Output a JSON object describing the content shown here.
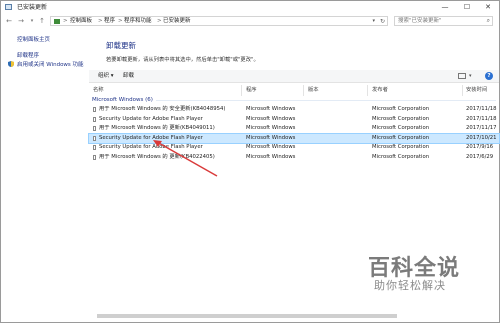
{
  "window": {
    "title": "已安装更新",
    "min_label": "—",
    "max_label": "☐",
    "close_label": "✕"
  },
  "nav": {
    "back": "←",
    "forward": "→",
    "up": "↑",
    "breadcrumbs": [
      "控制面板",
      "程序",
      "程序和功能",
      "已安装更新"
    ],
    "separator": ">",
    "search_placeholder": "搜索\"已安装更新\""
  },
  "sidebar": {
    "items": [
      {
        "label": "控制面板主页"
      },
      {
        "label": "卸载程序"
      },
      {
        "label": "启用或关闭 Windows 功能"
      }
    ]
  },
  "main": {
    "heading": "卸载更新",
    "subtext": "若要卸载更新，请从列表中将其选中，然后单击\"卸载\"或\"更改\"。",
    "toolbar": {
      "organize": "组织 ▾",
      "uninstall": "卸载"
    },
    "columns": [
      "名称",
      "程序",
      "版本",
      "发布者",
      "安装时间"
    ],
    "group": "Microsoft Windows (6)",
    "rows": [
      {
        "name": "用于 Microsoft Windows 的 安全更新(KB4048954)",
        "program": "Microsoft Windows",
        "version": "",
        "publisher": "Microsoft Corporation",
        "date": "2017/11/18",
        "selected": false
      },
      {
        "name": "Security Update for Adobe Flash Player",
        "program": "Microsoft Windows",
        "version": "",
        "publisher": "Microsoft Corporation",
        "date": "2017/11/18",
        "selected": false
      },
      {
        "name": "用于 Microsoft Windows 的 更新(KB4049011)",
        "program": "Microsoft Windows",
        "version": "",
        "publisher": "Microsoft Corporation",
        "date": "2017/11/17",
        "selected": false
      },
      {
        "name": "Security Update for Adobe Flash Player",
        "program": "Microsoft Windows",
        "version": "",
        "publisher": "Microsoft Corporation",
        "date": "2017/10/21",
        "selected": true
      },
      {
        "name": "Security Update for Adobe Flash Player",
        "program": "Microsoft Windows",
        "version": "",
        "publisher": "Microsoft Corporation",
        "date": "2017/9/16",
        "selected": false
      },
      {
        "name": "用于 Microsoft Windows 的 更新(KB4022405)",
        "program": "Microsoft Windows",
        "version": "",
        "publisher": "Microsoft Corporation",
        "date": "2017/6/29",
        "selected": false
      }
    ]
  },
  "watermark": {
    "logo": "百科全说",
    "tagline": "助你轻松解决"
  },
  "colors": {
    "link": "#1e3287",
    "selection": "#cce8ff",
    "arrow": "#d93a3a"
  }
}
